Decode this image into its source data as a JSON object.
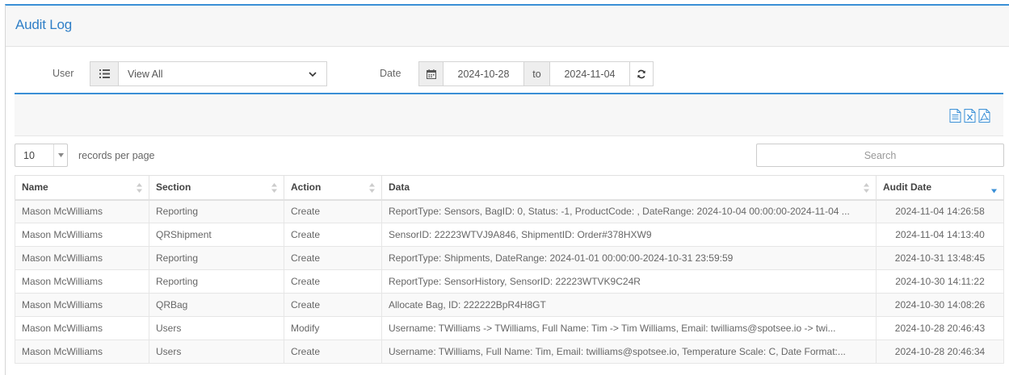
{
  "header": {
    "title": "Audit Log"
  },
  "filters": {
    "user_label": "User",
    "user_value": "View All",
    "date_label": "Date",
    "date_from": "2024-10-28",
    "date_to_label": "to",
    "date_to": "2024-11-04"
  },
  "export": {
    "icons": [
      "csv-export-icon",
      "excel-export-icon",
      "pdf-export-icon"
    ]
  },
  "table_controls": {
    "page_length": "10",
    "records_per_page": "records per page",
    "search_placeholder": "Search"
  },
  "table": {
    "columns": [
      "Name",
      "Section",
      "Action",
      "Data",
      "Audit Date"
    ],
    "sorted_column": "Audit Date",
    "sort_direction": "descending",
    "rows": [
      [
        "Mason McWilliams",
        "Reporting",
        "Create",
        "ReportType: Sensors, BagID: 0, Status: -1, ProductCode: , DateRange: 2024-10-04 00:00:00-2024-11-04 ...",
        "2024-11-04 14:26:58"
      ],
      [
        "Mason McWilliams",
        "QRShipment",
        "Create",
        "SensorID: 22223WTVJ9A846, ShipmentID: Order#378HXW9",
        "2024-11-04 14:13:40"
      ],
      [
        "Mason McWilliams",
        "Reporting",
        "Create",
        "ReportType: Shipments, DateRange: 2024-01-01 00:00:00-2024-10-31 23:59:59",
        "2024-10-31 13:48:45"
      ],
      [
        "Mason McWilliams",
        "Reporting",
        "Create",
        "ReportType: SensorHistory, SensorID: 22223WTVK9C24R",
        "2024-10-30 14:11:22"
      ],
      [
        "Mason McWilliams",
        "QRBag",
        "Create",
        "Allocate Bag, ID: 222222BpR4H8GT",
        "2024-10-30 14:08:26"
      ],
      [
        "Mason McWilliams",
        "Users",
        "Modify",
        "Username: TWilliams -> TWilliams, Full Name: Tim -> Tim Williams, Email: twilliams@spotsee.io -> twi...",
        "2024-10-28 20:46:43"
      ],
      [
        "Mason McWilliams",
        "Users",
        "Create",
        "Username: TWilliams, Full Name: Tim, Email: twilliams@spotsee.io, Temperature Scale: C, Date Format:...",
        "2024-10-28 20:46:34"
      ]
    ]
  },
  "colors": {
    "accent": "#3a8fd6",
    "title": "#2f7fc7"
  }
}
